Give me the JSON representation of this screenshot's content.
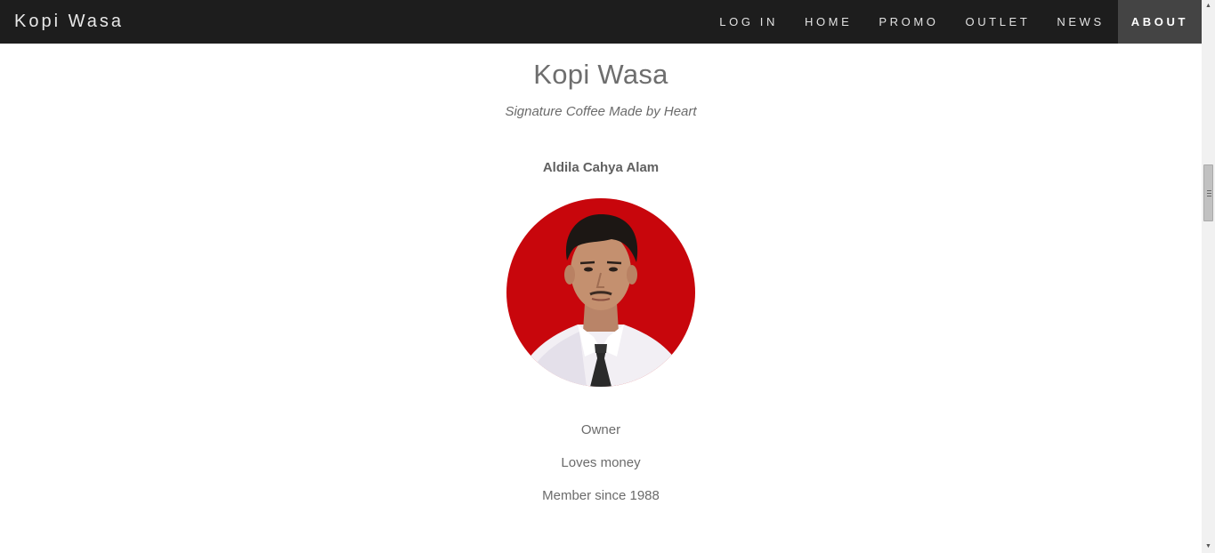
{
  "navbar": {
    "brand": "Kopi Wasa",
    "items": [
      {
        "label": "LOG IN",
        "active": false
      },
      {
        "label": "HOME",
        "active": false
      },
      {
        "label": "PROMO",
        "active": false
      },
      {
        "label": "OUTLET",
        "active": false
      },
      {
        "label": "NEWS",
        "active": false
      },
      {
        "label": "ABOUT",
        "active": true
      }
    ]
  },
  "main": {
    "title": "Kopi Wasa",
    "tagline": "Signature Coffee Made by Heart",
    "profile": {
      "name": "Aldila Cahya Alam",
      "role": "Owner",
      "trait": "Loves money",
      "member_since": "Member since 1988"
    }
  },
  "colors": {
    "navbar_bg": "#1d1d1d",
    "active_nav_bg": "#444444",
    "avatar_bg": "#c8060c"
  }
}
